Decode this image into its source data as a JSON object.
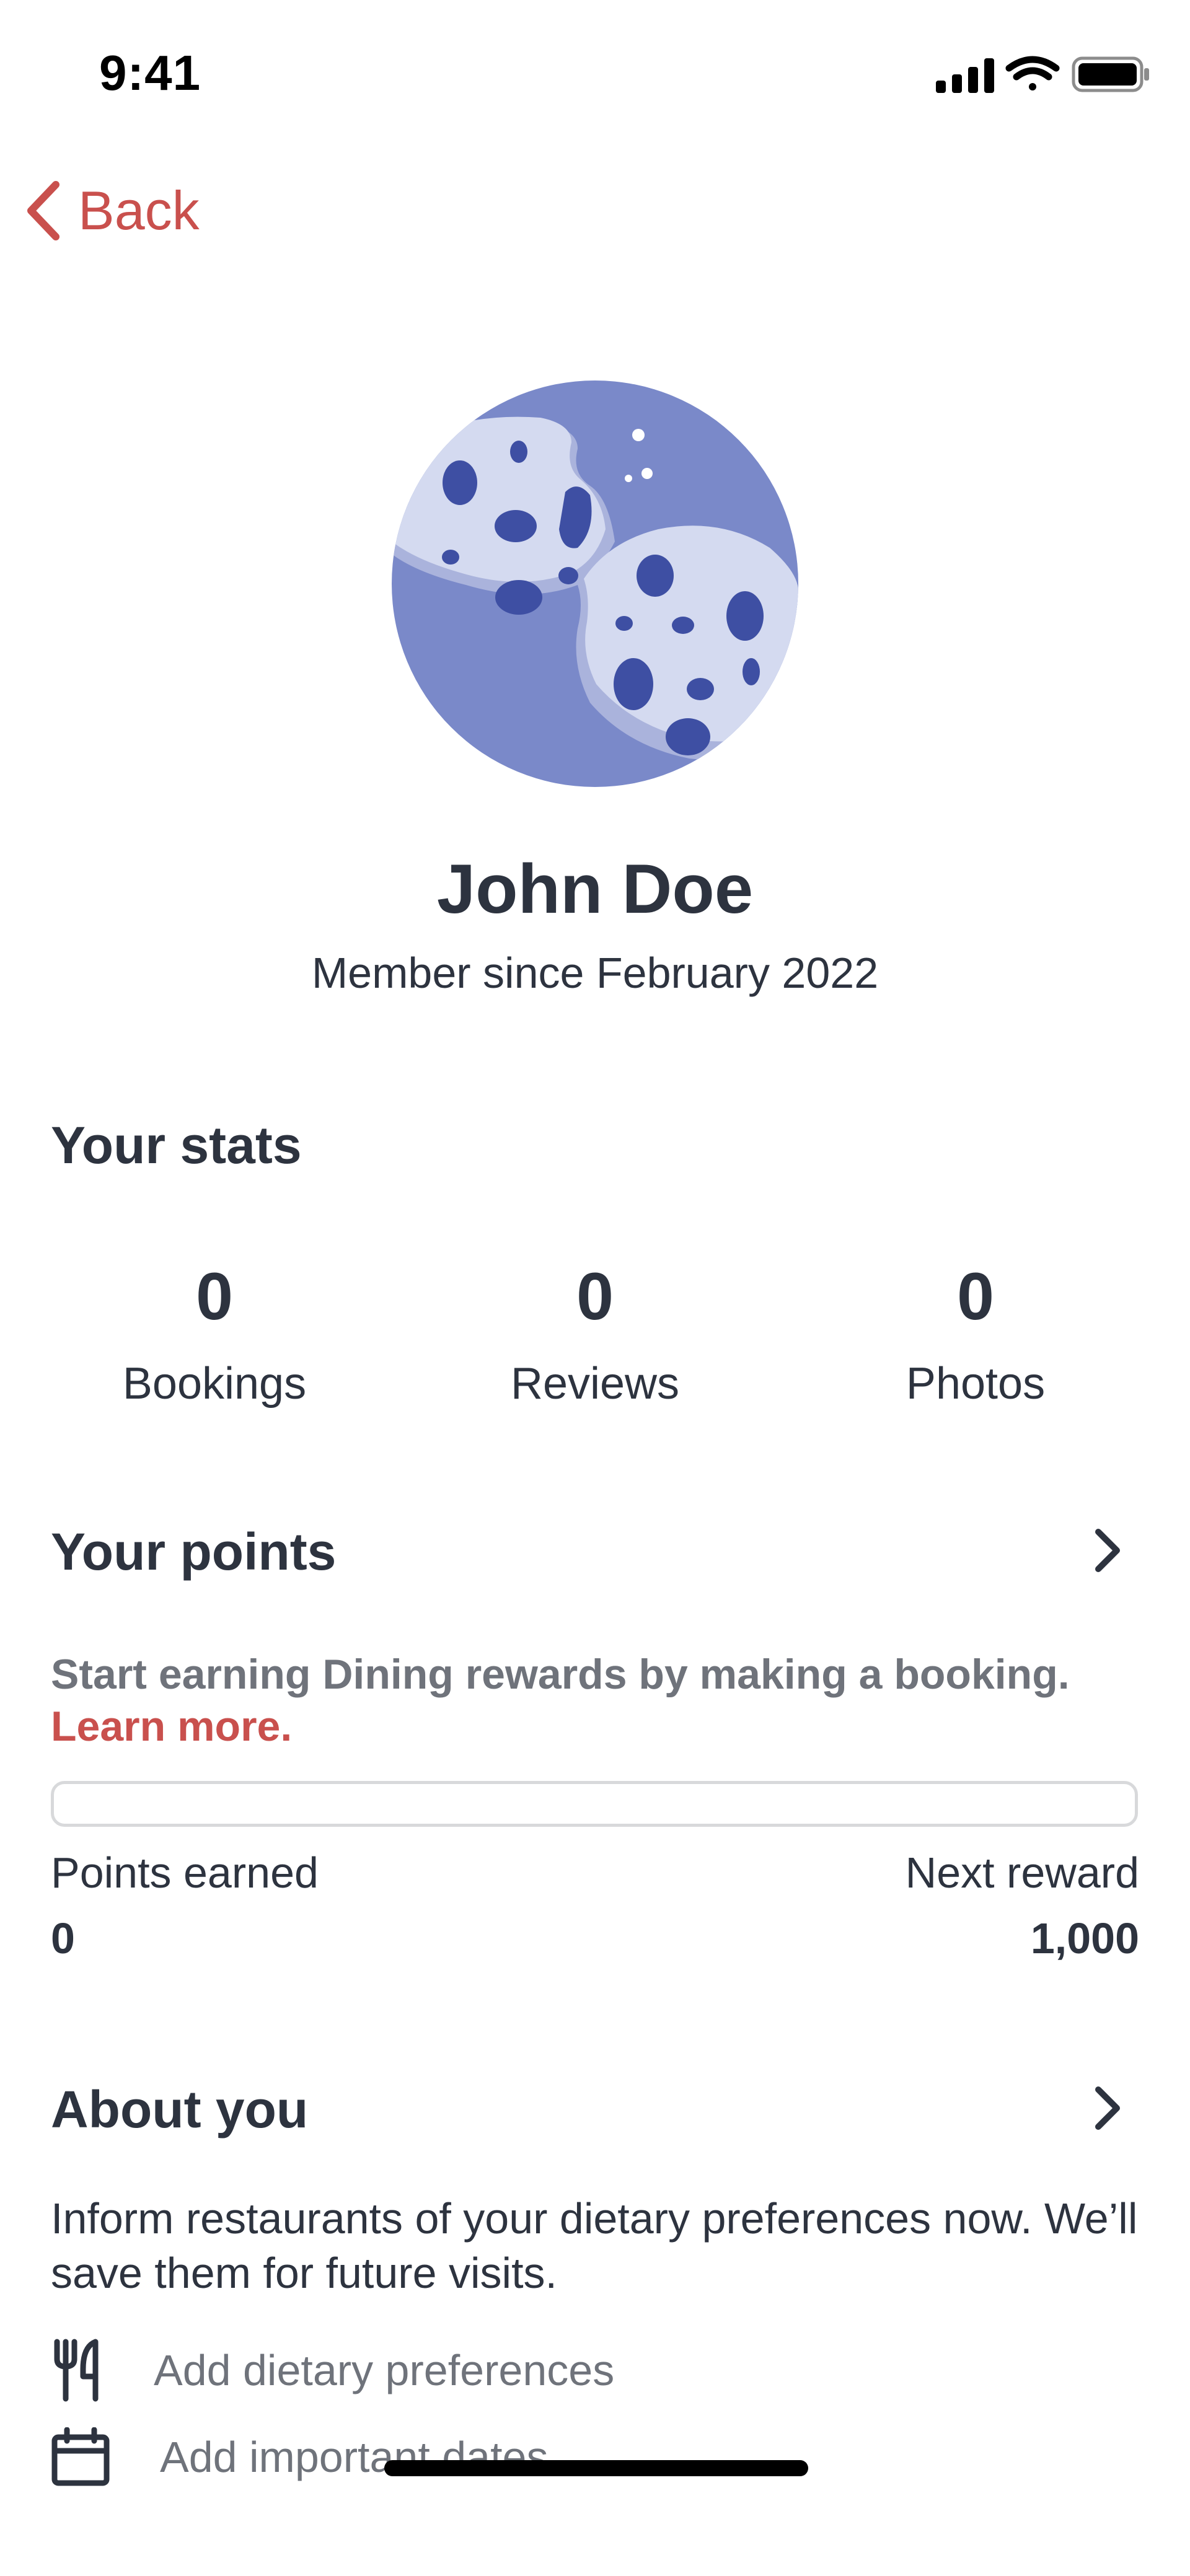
{
  "status_bar": {
    "time": "9:41",
    "icons": [
      "cellular-signal-icon",
      "wifi-icon",
      "battery-icon"
    ]
  },
  "nav": {
    "back_label": "Back"
  },
  "profile": {
    "name": "John Doe",
    "member_since": "Member since February 2022",
    "avatar_icon": "cookie-avatar-icon"
  },
  "stats": {
    "title": "Your stats",
    "items": [
      {
        "value": "0",
        "label": "Bookings"
      },
      {
        "value": "0",
        "label": "Reviews"
      },
      {
        "value": "0",
        "label": "Photos"
      }
    ]
  },
  "points": {
    "title": "Your points",
    "description": "Start earning Dining rewards by making a booking.",
    "learn_more": "Learn more.",
    "progress_fraction": 0,
    "earned_label": "Points earned",
    "earned_value": "0",
    "next_label": "Next reward",
    "next_value": "1,000"
  },
  "about": {
    "title": "About you",
    "description": "Inform restaurants of your dietary preferences now. We’ll save them for future visits.",
    "actions": [
      {
        "label": "Add dietary preferences",
        "icon": "fork-knife-icon"
      },
      {
        "label": "Add important dates",
        "icon": "calendar-icon"
      }
    ]
  },
  "colors": {
    "accent": "#c9504d",
    "text": "#2d333f",
    "muted": "#6f737b",
    "avatar_bg": "#7a89c9",
    "cookie": "#d4daf0",
    "chip": "#3e4fa3"
  }
}
